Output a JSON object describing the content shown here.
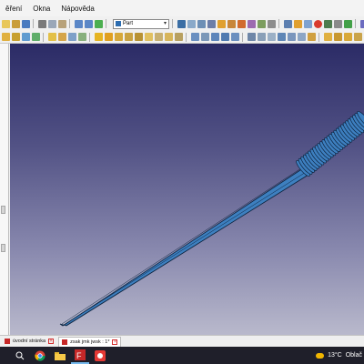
{
  "menu": {
    "items": [
      "ěření",
      "Okna",
      "Nápověda"
    ]
  },
  "toolbar": {
    "workbench": "Part"
  },
  "tabs": [
    {
      "label": "úvodní stránka"
    },
    {
      "label": "zsak jmk jwsk : 1*"
    }
  ],
  "taskbar": {
    "temperature": "13°C",
    "weather_text": "Oblač"
  },
  "icons": {
    "search": "search-icon",
    "chrome": "chrome-icon",
    "files": "folder-icon",
    "freecad": "freecad-icon",
    "notes": "sticky-notes-icon"
  },
  "colors": {
    "view_top": "#2b2b66",
    "view_bottom": "#b9b9cc",
    "model_fill": "#3d7fbf",
    "model_edge": "#0d2440"
  }
}
